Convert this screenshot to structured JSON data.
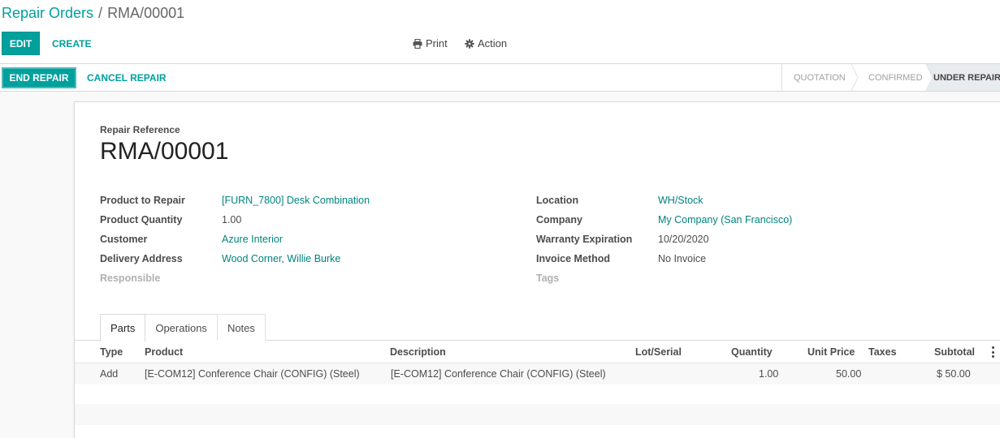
{
  "breadcrumb": {
    "parent": "Repair Orders",
    "separator": "/",
    "current": "RMA/00001"
  },
  "toolbar": {
    "edit_label": "EDIT",
    "create_label": "CREATE",
    "print_label": "Print",
    "action_label": "Action"
  },
  "statusbar": {
    "end_repair_label": "END REPAIR",
    "cancel_repair_label": "CANCEL REPAIR",
    "stages": [
      "QUOTATION",
      "CONFIRMED",
      "UNDER REPAIR"
    ],
    "active_stage": "UNDER REPAIR"
  },
  "form": {
    "ref_label": "Repair Reference",
    "ref_value": "RMA/00001",
    "left_fields": [
      {
        "label": "Product to Repair",
        "value": "[FURN_7800] Desk Combination"
      },
      {
        "label": "Product Quantity",
        "value": "1.00"
      },
      {
        "label": "Customer",
        "value": "Azure Interior"
      },
      {
        "label": "Delivery Address",
        "value": "Wood Corner, Willie Burke"
      },
      {
        "label": "Responsible",
        "value": ""
      }
    ],
    "right_fields": [
      {
        "label": "Location",
        "value": "WH/Stock"
      },
      {
        "label": "Company",
        "value": "My Company (San Francisco)"
      },
      {
        "label": "Warranty Expiration",
        "value": "10/20/2020"
      },
      {
        "label": "Invoice Method",
        "value": "No Invoice"
      },
      {
        "label": "Tags",
        "value": ""
      }
    ]
  },
  "tabs": [
    "Parts",
    "Operations",
    "Notes"
  ],
  "active_tab": "Parts",
  "table": {
    "columns": [
      "Type",
      "Product",
      "Description",
      "Lot/Serial",
      "Quantity",
      "Unit Price",
      "Taxes",
      "Subtotal"
    ],
    "rows": [
      {
        "type": "Add",
        "product": "[E-COM12] Conference Chair (CONFIG) (Steel)",
        "description": "[E-COM12] Conference Chair (CONFIG) (Steel)",
        "lot": "",
        "quantity": "1.00",
        "unit_price": "50.00",
        "taxes": "",
        "subtotal": "$ 50.00"
      }
    ]
  },
  "colors": {
    "accent": "#00a09d",
    "link": "#00847f"
  },
  "icons": {
    "print": "printer-icon",
    "action": "gear-icon",
    "options": "kebab-menu-icon"
  }
}
